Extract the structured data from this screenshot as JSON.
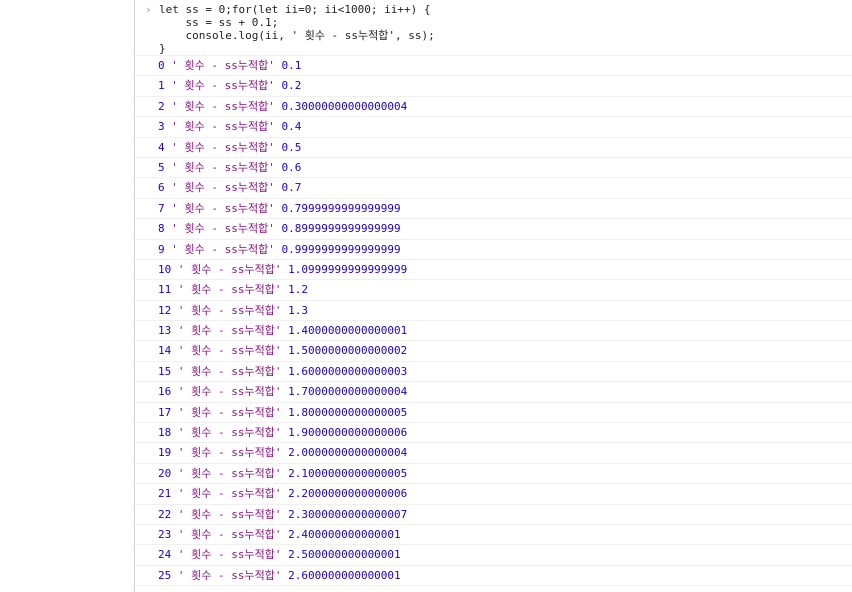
{
  "input": {
    "prompt_icon": "chevron-right-icon",
    "code_lines": [
      "let ss = 0;for(let ii=0; ii<1000; ii++) {",
      "    ss = ss + 0.1;",
      "    console.log(ii, ' 횟수 - ss누적합', ss);",
      "}"
    ]
  },
  "logs": [
    {
      "index": "0",
      "label": "' 횟수 - ss누적합'",
      "value": "0.1"
    },
    {
      "index": "1",
      "label": "' 횟수 - ss누적합'",
      "value": "0.2"
    },
    {
      "index": "2",
      "label": "' 횟수 - ss누적합'",
      "value": "0.30000000000000004"
    },
    {
      "index": "3",
      "label": "' 횟수 - ss누적합'",
      "value": "0.4"
    },
    {
      "index": "4",
      "label": "' 횟수 - ss누적합'",
      "value": "0.5"
    },
    {
      "index": "5",
      "label": "' 횟수 - ss누적합'",
      "value": "0.6"
    },
    {
      "index": "6",
      "label": "' 횟수 - ss누적합'",
      "value": "0.7"
    },
    {
      "index": "7",
      "label": "' 횟수 - ss누적합'",
      "value": "0.7999999999999999"
    },
    {
      "index": "8",
      "label": "' 횟수 - ss누적합'",
      "value": "0.8999999999999999"
    },
    {
      "index": "9",
      "label": "' 횟수 - ss누적합'",
      "value": "0.9999999999999999"
    },
    {
      "index": "10",
      "label": "' 횟수 - ss누적합'",
      "value": "1.0999999999999999"
    },
    {
      "index": "11",
      "label": "' 횟수 - ss누적합'",
      "value": "1.2"
    },
    {
      "index": "12",
      "label": "' 횟수 - ss누적합'",
      "value": "1.3"
    },
    {
      "index": "13",
      "label": "' 횟수 - ss누적합'",
      "value": "1.4000000000000001"
    },
    {
      "index": "14",
      "label": "' 횟수 - ss누적합'",
      "value": "1.5000000000000002"
    },
    {
      "index": "15",
      "label": "' 횟수 - ss누적합'",
      "value": "1.6000000000000003"
    },
    {
      "index": "16",
      "label": "' 횟수 - ss누적합'",
      "value": "1.7000000000000004"
    },
    {
      "index": "17",
      "label": "' 횟수 - ss누적합'",
      "value": "1.8000000000000005"
    },
    {
      "index": "18",
      "label": "' 횟수 - ss누적합'",
      "value": "1.9000000000000006"
    },
    {
      "index": "19",
      "label": "' 횟수 - ss누적합'",
      "value": "2.0000000000000004"
    },
    {
      "index": "20",
      "label": "' 횟수 - ss누적합'",
      "value": "2.1000000000000005"
    },
    {
      "index": "21",
      "label": "' 횟수 - ss누적합'",
      "value": "2.2000000000000006"
    },
    {
      "index": "22",
      "label": "' 횟수 - ss누적합'",
      "value": "2.3000000000000007"
    },
    {
      "index": "23",
      "label": "' 횟수 - ss누적합'",
      "value": "2.400000000000001"
    },
    {
      "index": "24",
      "label": "' 횟수 - ss누적합'",
      "value": "2.500000000000001"
    },
    {
      "index": "25",
      "label": "' 횟수 - ss누적합'",
      "value": "2.600000000000001"
    }
  ]
}
